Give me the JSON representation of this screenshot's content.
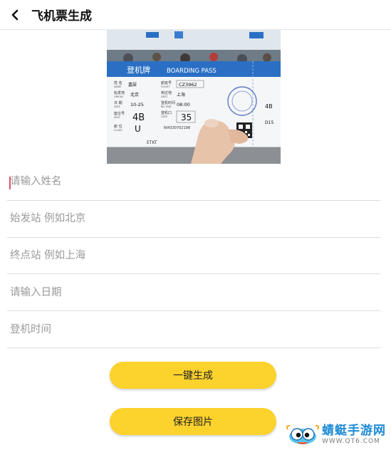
{
  "header": {
    "title": "飞机票生成"
  },
  "hero": {
    "pass": {
      "title_cn": "登机牌",
      "title_en": "BOARDING PASS",
      "name_label_cn": "姓 名",
      "name_label_en": "NAME",
      "name_value": "嘉尿",
      "flight_label_cn": "航班号",
      "flight_label_en": "FLIGHT",
      "flight_value": "CZ3962",
      "origin_label_cn": "始发地",
      "origin_label_en": "ORIGIN",
      "origin_value": "北京",
      "dest_label_cn": "到达地",
      "dest_label_en": "DEST",
      "dest_value": "上海",
      "date_label_cn": "日 期",
      "date_label_en": "DATE",
      "date_value": "10-25",
      "time_label_cn": "登机时间",
      "time_label_en": "BD TIME",
      "time_value": "08:00",
      "seat_label_cn": "座位号",
      "seat_label_en": "SEAT",
      "seat_value": "4B",
      "gate_label_cn": "登机口",
      "gate_label_en": "GATE",
      "gate_value": "35",
      "class_label_cn": "舱 位",
      "class_label_en": "CLASS",
      "class_value": "U",
      "ticket_no": "NI4330702198",
      "etkt": "ETKT",
      "stub_seat": "4B",
      "stub_gate": "D15"
    }
  },
  "form": {
    "name_placeholder": "请输入姓名",
    "origin_placeholder": "始发站 例如北京",
    "dest_placeholder": "终点站 例如上海",
    "date_placeholder": "请输入日期",
    "time_placeholder": "登机时间"
  },
  "buttons": {
    "generate": "一键生成",
    "save": "保存图片"
  },
  "watermark": {
    "brand": "蜻蜓手游网",
    "url": "WWW.QT6.COM"
  },
  "colors": {
    "accent": "#fcd22d",
    "pass_blue": "#2a6fc4",
    "watermark_blue": "#1d8ad6"
  }
}
